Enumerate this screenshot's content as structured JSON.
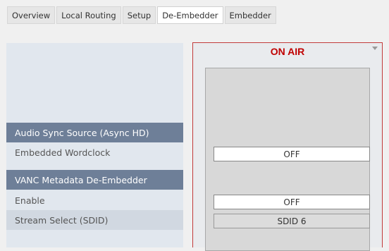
{
  "tabs": [
    {
      "label": "Overview",
      "active": false
    },
    {
      "label": "Local Routing",
      "active": false
    },
    {
      "label": "Setup",
      "active": false
    },
    {
      "label": "De-Embedder",
      "active": true
    },
    {
      "label": "Embedder",
      "active": false
    }
  ],
  "left_panel": {
    "audio_sync_header": "Audio Sync Source (Async HD)",
    "embedded_wordclock_label": "Embedded Wordclock",
    "vanc_header": "VANC Metadata De-Embedder",
    "enable_label": "Enable",
    "stream_select_label": "Stream Select (SDID)"
  },
  "channel": {
    "status": "ON AIR",
    "embedded_wordclock_value": "OFF",
    "enable_value": "OFF",
    "stream_select_value": "SDID 6"
  },
  "colors": {
    "header_bg": "#6e7f98",
    "on_air": "#c00000",
    "channel_border": "#c23a3a"
  }
}
